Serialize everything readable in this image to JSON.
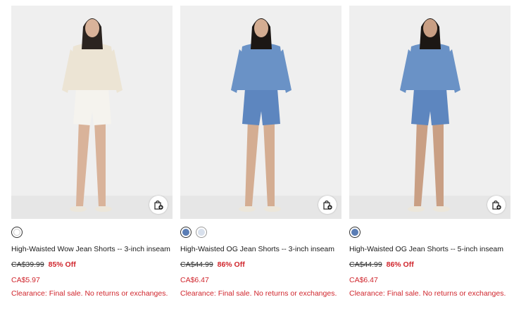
{
  "products": [
    {
      "name": "High-Waisted Wow Jean Shorts -- 3-inch inseam",
      "original_price": "CA$39.99",
      "discount": "85% Off",
      "sale_price": "CA$5.97",
      "note": "Clearance: Final sale. No returns or exchanges.",
      "swatches": [
        {
          "color": "#ffffff",
          "selected": true
        }
      ],
      "image": {
        "top_color": "#ece4d4",
        "shorts_color": "#f5f3ee",
        "skin": "#d9b39a",
        "hair": "#2b2420"
      }
    },
    {
      "name": "High-Waisted OG Jean Shorts -- 3-inch inseam",
      "original_price": "CA$44.99",
      "discount": "86% Off",
      "sale_price": "CA$6.47",
      "note": "Clearance: Final sale. No returns or exchanges.",
      "swatches": [
        {
          "color": "#5a7db5",
          "selected": true
        },
        {
          "color": "#d8e0ec",
          "selected": false
        }
      ],
      "image": {
        "top_color": "#6a92c6",
        "shorts_color": "#5d86bf",
        "skin": "#d4ad92",
        "hair": "#1c1714"
      }
    },
    {
      "name": "High-Waisted OG Jean Shorts -- 5-inch inseam",
      "original_price": "CA$44.99",
      "discount": "86% Off",
      "sale_price": "CA$6.47",
      "note": "Clearance: Final sale. No returns or exchanges.",
      "swatches": [
        {
          "color": "#5a7db5",
          "selected": true
        }
      ],
      "image": {
        "top_color": "#6a92c6",
        "shorts_color": "#5d86bf",
        "skin": "#c99f84",
        "hair": "#1c1714"
      }
    }
  ],
  "icons": {
    "bag": "shopping-bag-plus-icon"
  },
  "colors": {
    "sale_red": "#d0262d",
    "photo_bg": "#efefef"
  }
}
